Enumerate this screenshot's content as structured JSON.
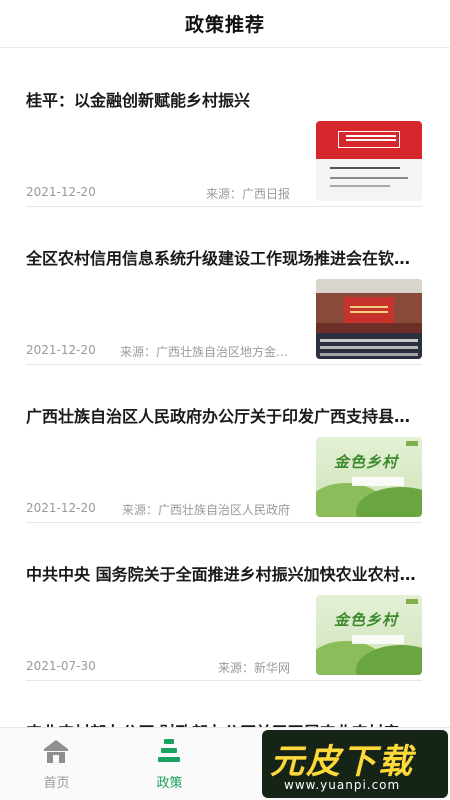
{
  "header": {
    "title": "政策推荐"
  },
  "articles": [
    {
      "title": "桂平：以金融创新赋能乡村振兴",
      "date": "2021-12-20",
      "source": "来源：广西日报"
    },
    {
      "title": "全区农村信用信息系统升级建设工作现场推进会在钦州召开",
      "date": "2021-12-20",
      "source": "来源：广西壮族自治区地方金融监督管理局"
    },
    {
      "title": "广西壮族自治区人民政府办公厅关于印发广西支持县域经济发展若干措施的通知",
      "date": "2021-12-20",
      "source": "来源：广西壮族自治区人民政府"
    },
    {
      "title": "中共中央 国务院关于全面推进乡村振兴加快农业农村现代化的意见",
      "date": "2021-07-30",
      "source": "来源：新华网"
    },
    {
      "title": "农业农村部办公厅 财政部办公厅关于开展农业农村产业融合项目"
    }
  ],
  "thumbs": {
    "green_caption": "金色乡村"
  },
  "tabbar": {
    "home_label": "首页",
    "policy_label": "政策"
  },
  "colors": {
    "accent": "#1aa260",
    "inactive": "#9a9a9a"
  },
  "watermark": {
    "main": "元皮下载",
    "url": "www.yuanpi.com"
  }
}
